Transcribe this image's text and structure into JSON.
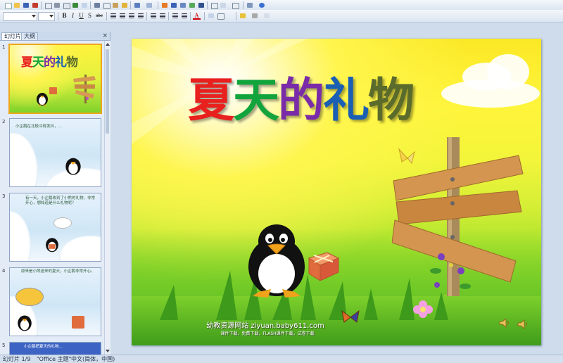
{
  "toolbar_row1": {
    "icons": [
      "new-icon",
      "open-icon",
      "save-icon",
      "permission-icon",
      "email-icon",
      "print-icon",
      "print-preview-icon",
      "spelling-icon",
      "research-icon",
      "cut-icon",
      "copy-icon",
      "paste-icon",
      "format-painter-icon",
      "undo-icon",
      "redo-icon",
      "insert-table-icon",
      "insert-chart-icon",
      "insert-shape-icon",
      "insert-picture-icon",
      "insert-textbox-icon",
      "slide-layout-icon",
      "design-icon",
      "new-slide-icon",
      "zoom-icon",
      "help-icon"
    ]
  },
  "toolbar_row2": {
    "font_name": "",
    "font_size": "",
    "bold_label": "B",
    "italic_label": "I",
    "underline_label": "U",
    "shadow_label": "S",
    "strike_label": "abc",
    "font_color_label": "A",
    "grow_font_label": "A",
    "shrink_font_label": "A"
  },
  "left_panel": {
    "tab_slides": "幻灯片",
    "tab_outline": "大纲",
    "close_glyph": "×",
    "slide_numbers": [
      "1",
      "2",
      "3",
      "4",
      "5"
    ],
    "thumb1_title": [
      "夏",
      "天",
      "的",
      "礼",
      "物"
    ],
    "thumb2_text": "小企鹅在北极冷得发抖，…",
    "thumb3_text": "有一天，小企鹅收到了小熊的礼物，非常开心，想知道是什么礼物呢？",
    "thumb4_text": "原来是小熊送来的夏天，小企鹅非常开心。",
    "thumb5_text": "小企鹅把夏天的礼物…"
  },
  "slide": {
    "title_chars": [
      {
        "char": "夏",
        "color": "#e8201e"
      },
      {
        "char": "天",
        "color": "#12a43c"
      },
      {
        "char": "的",
        "color": "#7a2ca8"
      },
      {
        "char": "礼",
        "color": "#1a5fb4"
      },
      {
        "char": "物",
        "color": "#5a6b2b"
      }
    ],
    "watermark": "幼教资源网站 ziyuan.baby611.com",
    "watermark_small": "课件下载，免费下载，FLASH课件下载，试卷下载"
  },
  "status_bar": {
    "slide_counter": "幻灯片 1/9",
    "theme": "\"Office 主题\"",
    "language": "中文(简体，中国)"
  },
  "colors": {
    "ribbon_bg": "#dbe5f1",
    "panel_bg": "#e3ebf6",
    "selection": "#f0a51c"
  }
}
